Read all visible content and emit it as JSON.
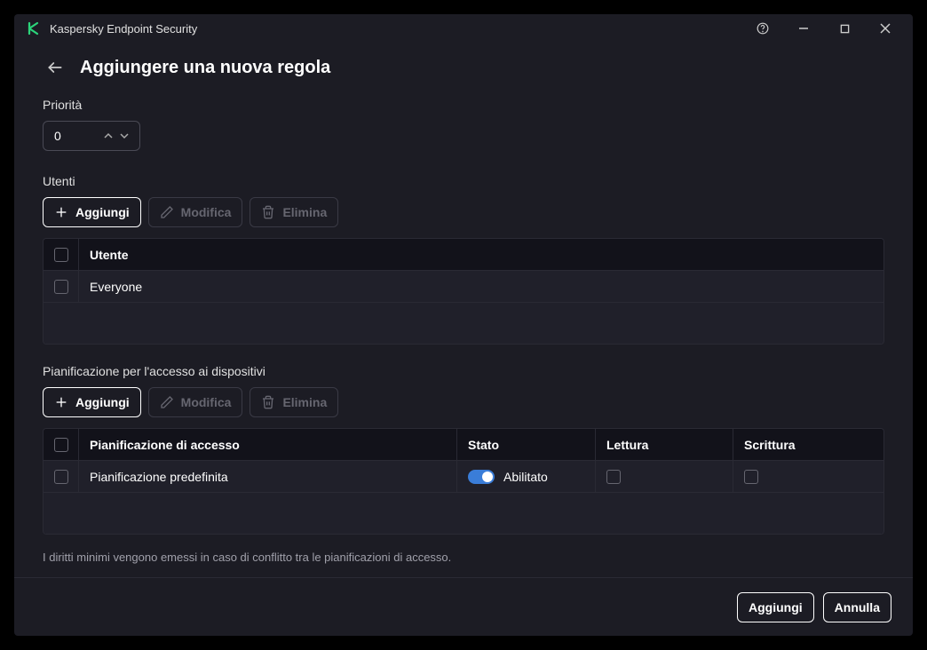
{
  "app_title": "Kaspersky Endpoint Security",
  "page_title": "Aggiungere una nuova regola",
  "priority": {
    "label": "Priorità",
    "value": "0"
  },
  "users": {
    "label": "Utenti",
    "buttons": {
      "add": "Aggiungi",
      "edit": "Modifica",
      "delete": "Elimina"
    },
    "header": "Utente",
    "rows": [
      "Everyone"
    ]
  },
  "schedule": {
    "label": "Pianificazione per l'accesso ai dispositivi",
    "buttons": {
      "add": "Aggiungi",
      "edit": "Modifica",
      "delete": "Elimina"
    },
    "columns": {
      "name": "Pianificazione di accesso",
      "state": "Stato",
      "read": "Lettura",
      "write": "Scrittura"
    },
    "rows": [
      {
        "name": "Pianificazione predefinita",
        "state_label": "Abilitato",
        "enabled": true
      }
    ]
  },
  "note": "I diritti minimi vengono emessi in caso di conflitto tra le pianificazioni di accesso.",
  "footer": {
    "add": "Aggiungi",
    "cancel": "Annulla"
  }
}
